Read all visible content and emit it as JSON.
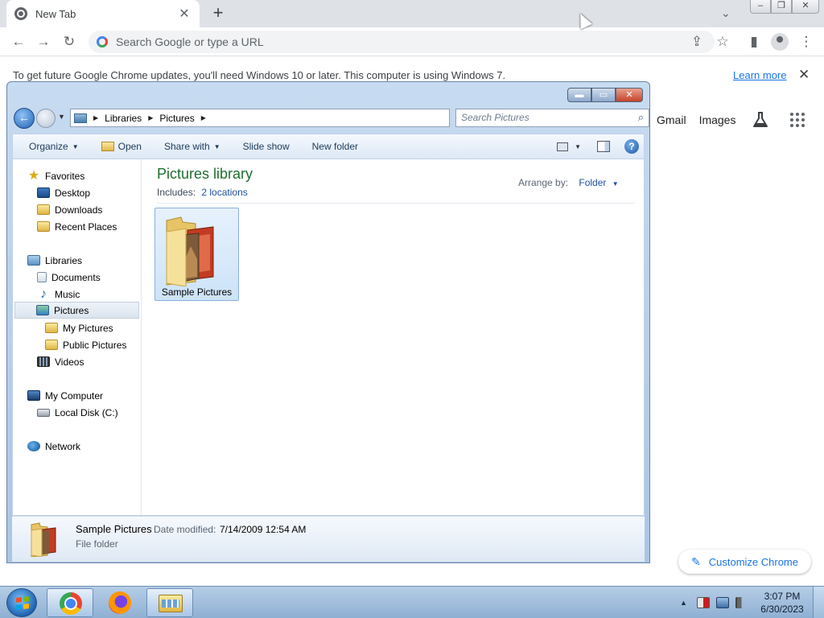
{
  "chrome": {
    "tab_title": "New Tab",
    "tab_close": "✕",
    "new_tab": "+",
    "tab_search": "⌄",
    "window_controls": {
      "minimize": "–",
      "restore": "❐",
      "close": "✕"
    },
    "toolbar": {
      "back": "←",
      "forward": "→",
      "reload": "↻",
      "omnibox_placeholder": "Search Google or type a URL",
      "share": "⇪",
      "bookmark": "☆",
      "side_panel": "▮",
      "menu": "⋮"
    },
    "infobar": {
      "message": "To get future Google Chrome updates, you'll need Windows 10 or later. This computer is using Windows 7.",
      "link": "Learn more",
      "close": "✕"
    },
    "ntp": {
      "gmail": "Gmail",
      "images": "Images",
      "customize": "Customize Chrome",
      "customize_icon": "✎"
    }
  },
  "explorer": {
    "window_controls": {
      "minimize": "▬",
      "maximize": "▭",
      "close": "✕"
    },
    "nav": {
      "back": "←",
      "history": "▼",
      "drop": "▼",
      "refresh": "⇆"
    },
    "address": {
      "crumbs": [
        "Libraries",
        "Pictures"
      ],
      "sep": "▶"
    },
    "search_placeholder": "Search Pictures",
    "search_icon": "⌕",
    "commands": {
      "organize": "Organize",
      "open": "Open",
      "share_with": "Share with",
      "slide_show": "Slide show",
      "new_folder": "New folder",
      "caret": "▼",
      "help": "?"
    },
    "nav_pane": {
      "favorites": "Favorites",
      "desktop": "Desktop",
      "downloads": "Downloads",
      "recent_places": "Recent Places",
      "libraries": "Libraries",
      "documents": "Documents",
      "music": "Music",
      "pictures": "Pictures",
      "my_pictures": "My Pictures",
      "public_pictures": "Public Pictures",
      "videos": "Videos",
      "my_computer": "My Computer",
      "local_disk": "Local Disk (C:)",
      "network": "Network",
      "star_glyph": "★",
      "music_glyph": "♪"
    },
    "library": {
      "title": "Pictures library",
      "includes_label": "Includes:",
      "locations": "2 locations",
      "arrange_label": "Arrange by:",
      "arrange_value": "Folder"
    },
    "items": [
      {
        "name": "Sample Pictures"
      }
    ],
    "details": {
      "name": "Sample Pictures",
      "date_label": "Date modified:",
      "date_value": "7/14/2009 12:54 AM",
      "type": "File folder"
    }
  },
  "taskbar": {
    "time": "3:07 PM",
    "date": "6/30/2023",
    "tray_arrow": "▲"
  },
  "colors": {
    "chrome_blue": "#1a73e8",
    "library_title": "#1e6e2e",
    "link_blue": "#1c4f9c"
  }
}
